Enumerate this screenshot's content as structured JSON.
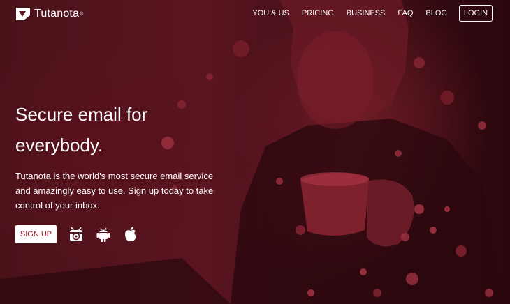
{
  "brand": {
    "name": "Tutanota",
    "trademark": "®"
  },
  "nav": {
    "items": [
      {
        "label": "YOU & US"
      },
      {
        "label": "PRICING"
      },
      {
        "label": "BUSINESS"
      },
      {
        "label": "FAQ"
      },
      {
        "label": "BLOG"
      }
    ],
    "login_label": "LOGIN"
  },
  "hero": {
    "title": "Secure email for everybody.",
    "description": "Tutanota is the world's most secure email service and amazingly easy to use. Sign up today to take control of your inbox.",
    "signup_label": "SIGN UP",
    "app_icons": [
      "fdroid-icon",
      "android-icon",
      "apple-icon"
    ]
  },
  "colors": {
    "background": "#3a0d14",
    "accent": "#a0172b",
    "text": "#ffffff"
  }
}
